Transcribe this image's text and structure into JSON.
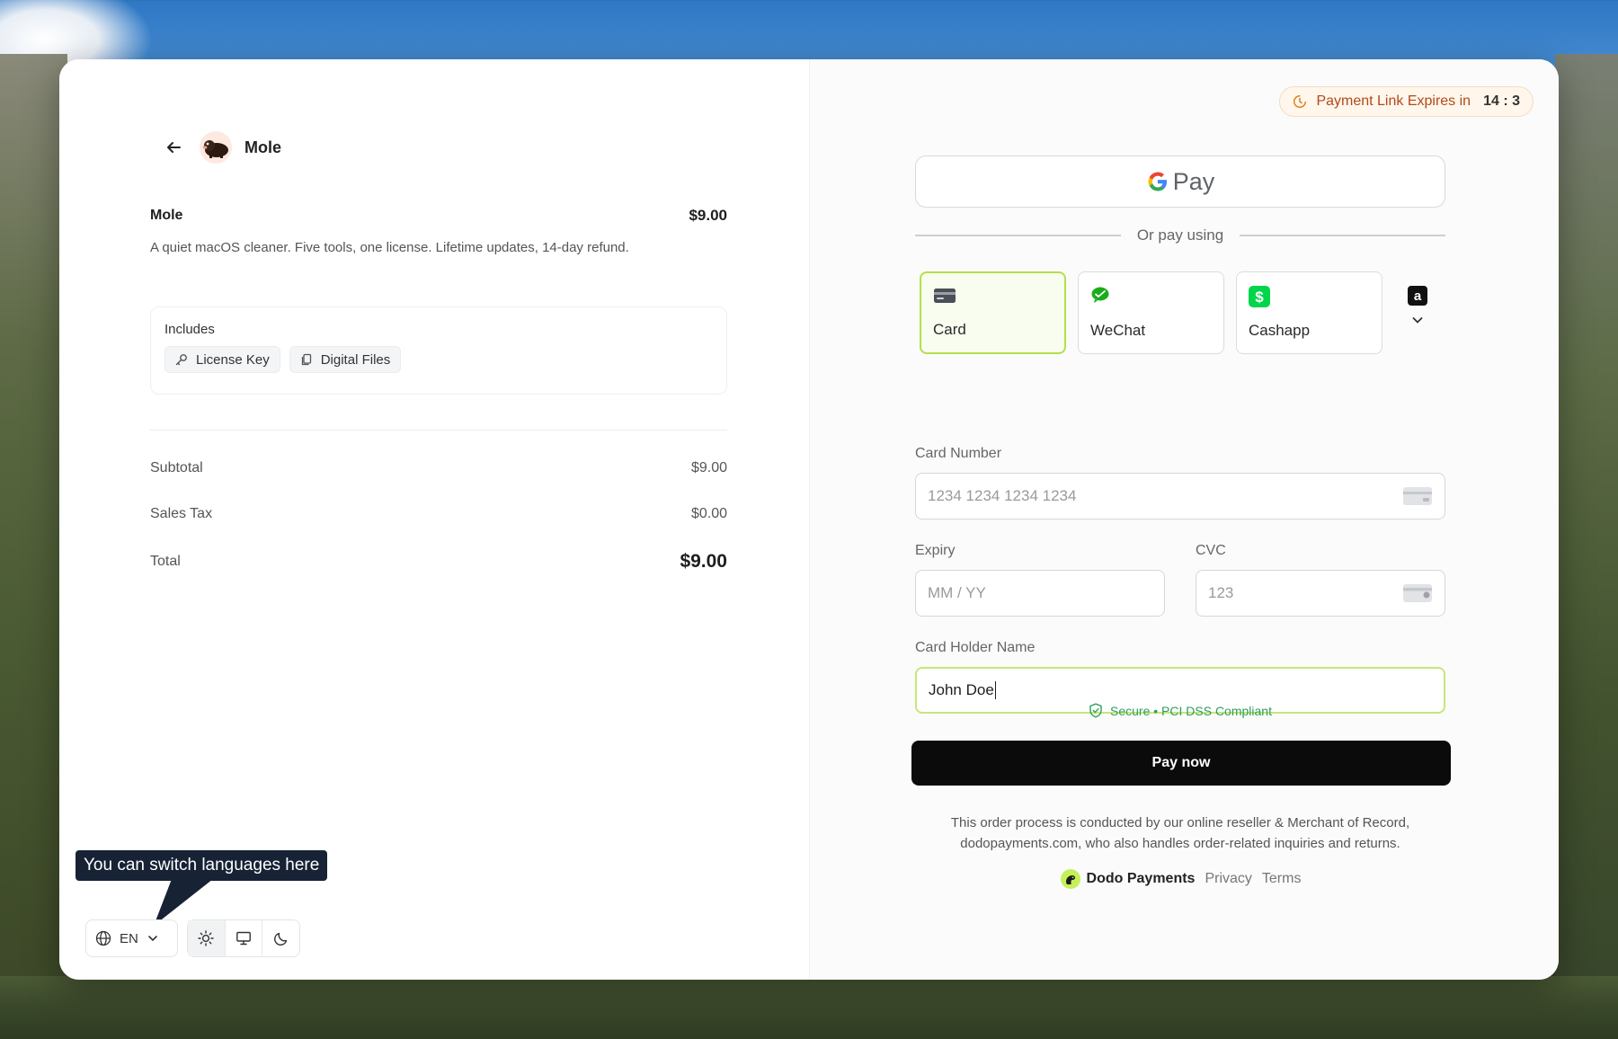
{
  "brand": {
    "name": "Mole"
  },
  "product": {
    "title": "Mole",
    "price": "$9.00",
    "description": "A quiet macOS cleaner. Five tools, one license. Lifetime updates, 14-day refund."
  },
  "includes": {
    "title": "Includes",
    "items": [
      {
        "label": "License Key",
        "icon": "key-icon"
      },
      {
        "label": "Digital Files",
        "icon": "files-icon"
      }
    ]
  },
  "summary": {
    "subtotal_label": "Subtotal",
    "subtotal_value": "$9.00",
    "tax_label": "Sales Tax",
    "tax_value": "$0.00",
    "total_label": "Total",
    "total_value": "$9.00"
  },
  "locale": {
    "tooltip": "You can switch languages here",
    "language": "EN"
  },
  "theme": {
    "options": [
      "light",
      "system",
      "dark"
    ],
    "selected": "light"
  },
  "expiry": {
    "label": "Payment Link Expires in",
    "time": "14 : 3"
  },
  "wallet": {
    "gpay_label": "Pay"
  },
  "or_text": "Or pay using",
  "methods": [
    {
      "label": "Card",
      "icon": "card-icon",
      "selected": true
    },
    {
      "label": "WeChat",
      "icon": "wechat-icon",
      "selected": false
    },
    {
      "label": "Cashapp",
      "icon": "cashapp-icon",
      "selected": false
    }
  ],
  "form": {
    "card_number_label": "Card Number",
    "card_number_placeholder": "1234 1234 1234 1234",
    "expiry_label": "Expiry",
    "expiry_placeholder": "MM / YY",
    "cvc_label": "CVC",
    "cvc_placeholder": "123",
    "holder_label": "Card Holder Name",
    "holder_value": "John Doe"
  },
  "secure_text": "Secure • PCI DSS Compliant",
  "pay_button": "Pay now",
  "disclaimer": "This order process is conducted by our online reseller & Merchant of Record, dodopayments.com, who also handles order-related inquiries and returns.",
  "footer": {
    "brand": "Dodo Payments",
    "privacy": "Privacy",
    "terms": "Terms"
  },
  "colors": {
    "accent_green": "#b4e04a",
    "secure_green": "#2f9e5b",
    "expiry_text": "#b24a19",
    "pay_button_bg": "#0b0b0b"
  }
}
